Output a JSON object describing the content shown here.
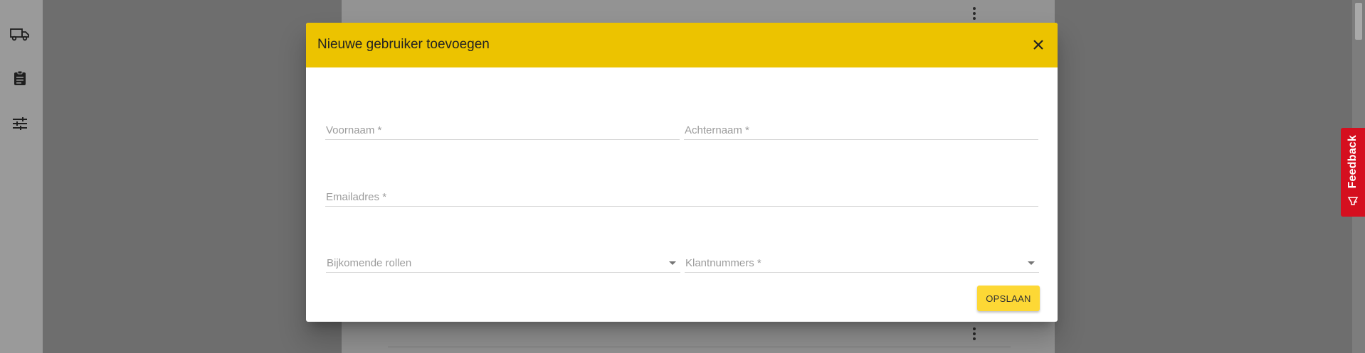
{
  "dialog": {
    "title": "Nieuwe gebruiker toevoegen",
    "fields": {
      "first_name": {
        "placeholder": "Voornaam *",
        "value": ""
      },
      "last_name": {
        "placeholder": "Achternaam *",
        "value": ""
      },
      "email": {
        "placeholder": "Emailadres *",
        "value": ""
      },
      "roles": {
        "placeholder": "Bijkomende rollen",
        "value": ""
      },
      "customer_numbers": {
        "placeholder": "Klantnummers *",
        "value": ""
      }
    },
    "save_label": "OPSLAAN"
  },
  "sidebar": {
    "items": [
      {
        "icon": "truck-icon"
      },
      {
        "icon": "clipboard-icon"
      },
      {
        "icon": "tune-icon"
      }
    ]
  },
  "feedback": {
    "label": "Feedback",
    "color": "#d50f1f"
  },
  "colors": {
    "header": "#ecc300",
    "save_button": "#fdd835"
  }
}
